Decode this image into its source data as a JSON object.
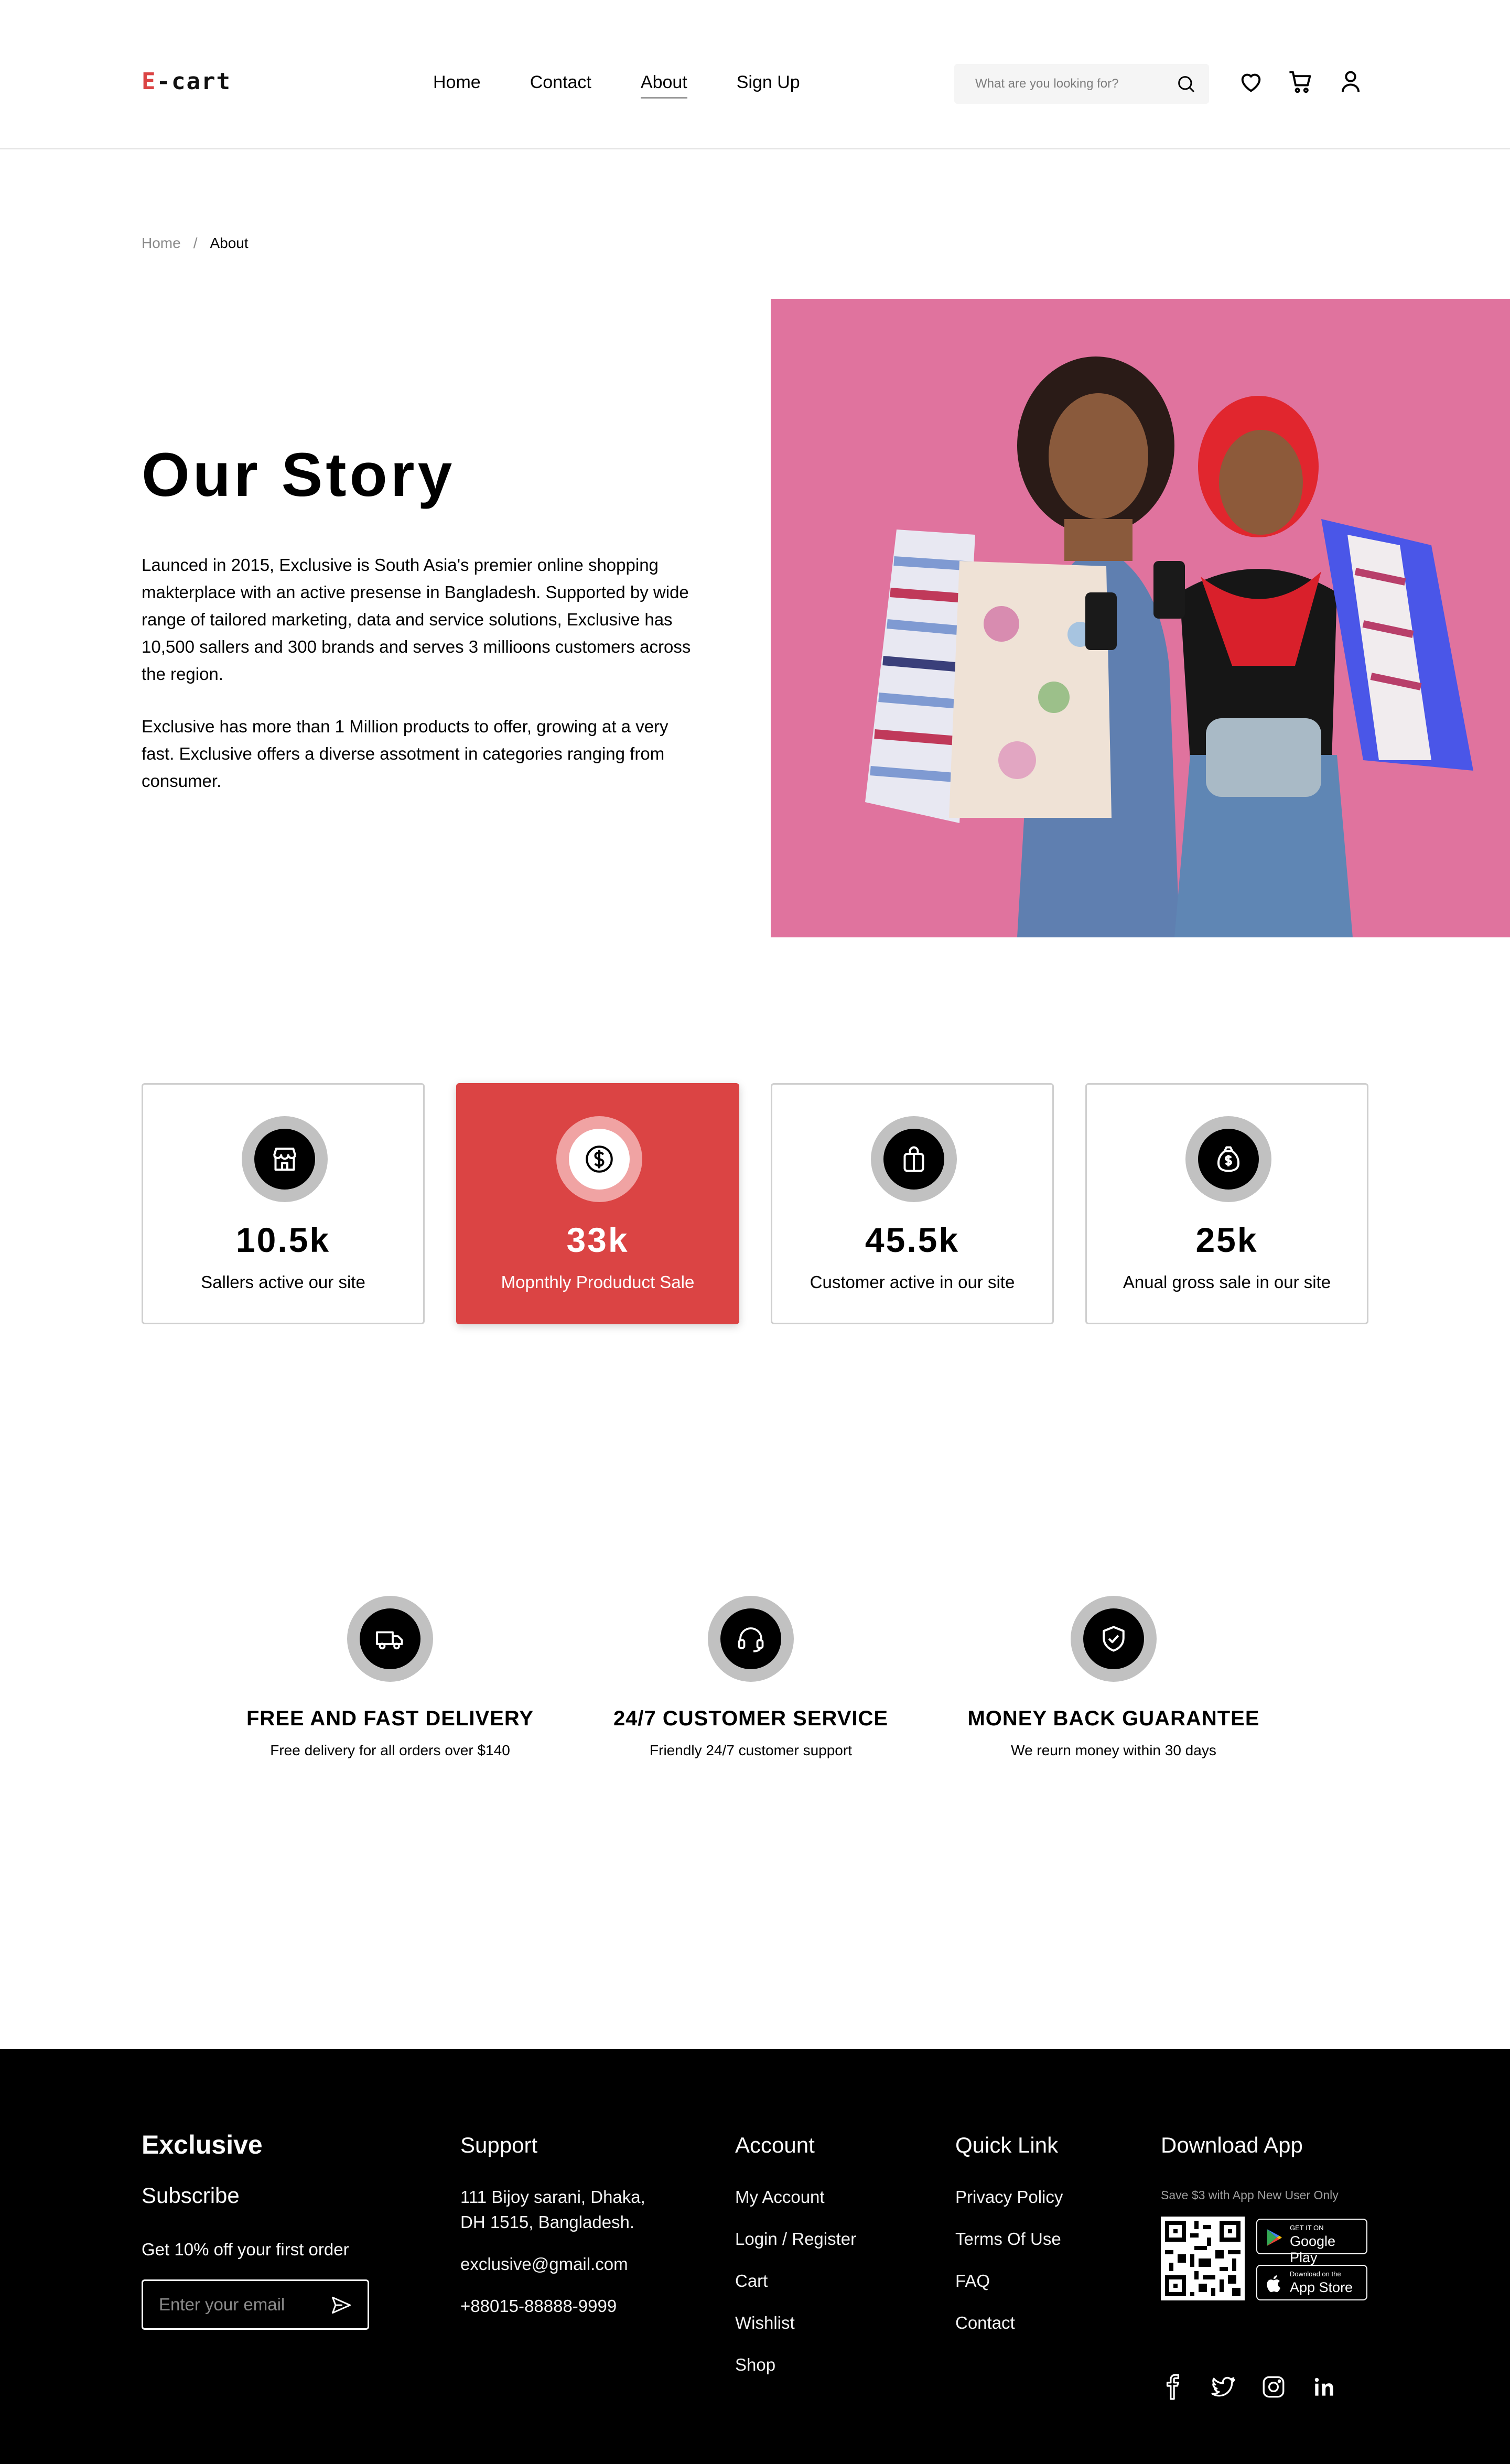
{
  "header": {
    "logo_prefix": "E",
    "logo_suffix": "-cart",
    "nav": [
      "Home",
      "Contact",
      "About",
      "Sign Up"
    ],
    "active_nav": "About",
    "search_placeholder": "What are you looking for?",
    "icons": [
      "search-icon",
      "heart-icon",
      "cart-icon",
      "user-icon"
    ]
  },
  "breadcrumb": {
    "home": "Home",
    "separator": "/",
    "current": "About"
  },
  "story": {
    "title": "Our Story",
    "paragraph1": "Launced in 2015, Exclusive is South Asia's premier online shopping makterplace with an active presense in Bangladesh. Supported by wide range of tailored marketing, data and service solutions, Exclusive has 10,500 sallers and 300 brands and serves 3 millioons customers across the region.",
    "paragraph2": "Exclusive has more than 1 Million products to offer, growing at a very fast. Exclusive offers a diverse assotment in categories ranging  from consumer."
  },
  "stats": [
    {
      "icon": "shop-icon",
      "value": "10.5k",
      "label": "Sallers active our site",
      "highlighted": false
    },
    {
      "icon": "dollar-coin-icon",
      "value": "33k",
      "label": "Mopnthly Produduct Sale",
      "highlighted": true
    },
    {
      "icon": "shopping-bag-icon",
      "value": "45.5k",
      "label": "Customer active in our site",
      "highlighted": false
    },
    {
      "icon": "money-bag-icon",
      "value": "25k",
      "label": "Anual gross sale in our site",
      "highlighted": false
    }
  ],
  "services": [
    {
      "icon": "delivery-truck-icon",
      "title": "FREE AND FAST DELIVERY",
      "desc": "Free delivery for all orders over $140"
    },
    {
      "icon": "headset-icon",
      "title": "24/7 CUSTOMER SERVICE",
      "desc": "Friendly 24/7 customer support"
    },
    {
      "icon": "shield-check-icon",
      "title": "MONEY BACK GUARANTEE",
      "desc": "We reurn money within 30 days"
    }
  ],
  "footer": {
    "brand": "Exclusive",
    "subscribe": "Subscribe",
    "offer": "Get 10% off your first order",
    "email_placeholder": "Enter your email",
    "support": {
      "title": "Support",
      "address_line1": "111 Bijoy sarani, Dhaka,",
      "address_line2": "DH 1515, Bangladesh.",
      "email": "exclusive@gmail.com",
      "phone": "+88015-88888-9999"
    },
    "account": {
      "title": "Account",
      "items": [
        "My Account",
        "Login / Register",
        "Cart",
        "Wishlist",
        "Shop"
      ]
    },
    "quick_link": {
      "title": "Quick Link",
      "items": [
        "Privacy Policy",
        "Terms Of Use",
        "FAQ",
        "Contact"
      ]
    },
    "download": {
      "title": "Download App",
      "note": "Save $3 with App New User Only",
      "google_small": "GET IT ON",
      "google_big": "Google Play",
      "apple_small": "Download on the",
      "apple_big": "App Store"
    },
    "social": [
      "facebook-icon",
      "twitter-icon",
      "instagram-icon",
      "linkedin-icon"
    ]
  },
  "colors": {
    "accent": "#db4444",
    "footer_bg": "#000000",
    "hero_bg": "#e0739e",
    "icon_ring": "#c1c1c1"
  }
}
